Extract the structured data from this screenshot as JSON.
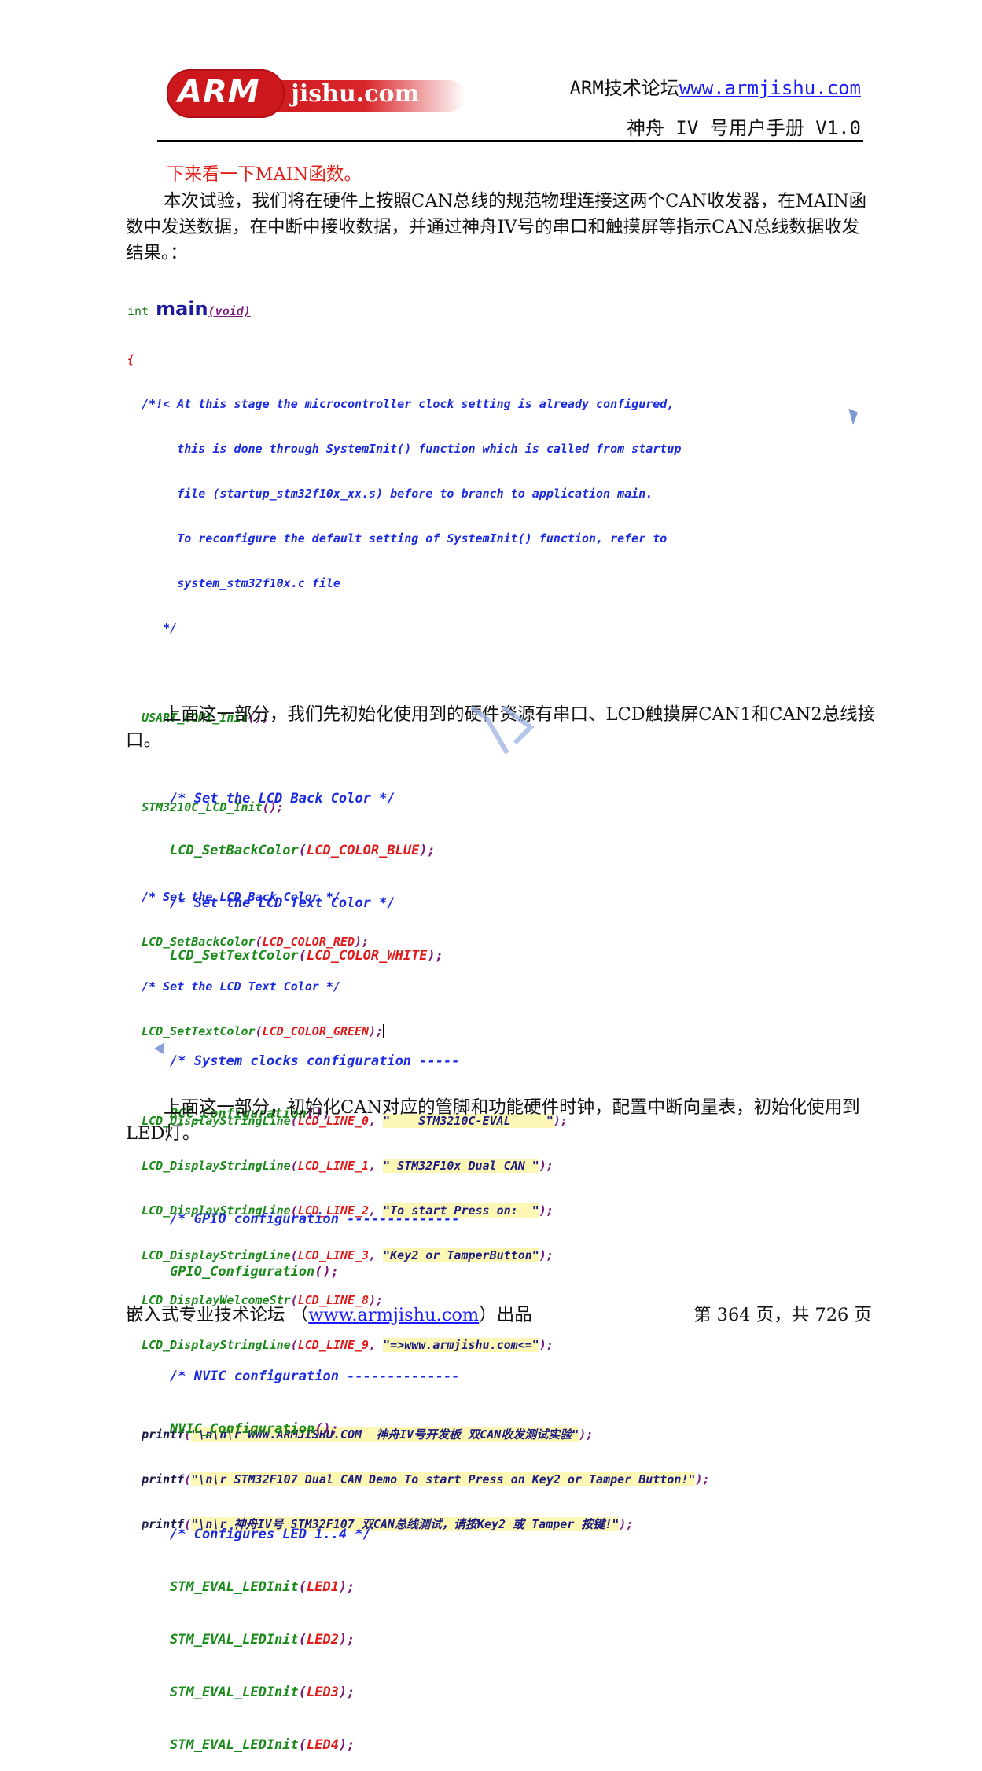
{
  "header": {
    "logo": {
      "arm": "ARM",
      "jishu": "jishu.com"
    },
    "forum_label": "ARM技术论坛",
    "forum_url": "www.armjishu.com",
    "manual_title": "神舟 IV 号用户手册 V1.0"
  },
  "colors": {
    "accent_red": "#e0201b",
    "link_blue": "#1a1aff",
    "code_green": "#1a8a1a",
    "code_comment_blue": "#1a2ae0",
    "code_arg_red": "#e01a1a",
    "code_paren_purple": "#7a1a7a",
    "string_highlight": "#fdf7b6"
  },
  "body": {
    "heading": "下来看一下MAIN函数。",
    "intro": "本次试验，我们将在硬件上按照CAN总线的规范物理连接这两个CAN收发器，在MAIN函数中发送数据，在中断中接收数据，并通过神舟IV号的串口和触摸屏等指示CAN总线数据收发结果。：",
    "para2": "上面这一部分，我们先初始化使用到的硬件资源有串口、LCD触摸屏CAN1和CAN2总线接口。",
    "para3": "上面这一部分，初始化CAN对应的管脚和功能硬件时钟，配置中断向量表，初始化使用到LED灯。"
  },
  "code1": {
    "sig_type": "int",
    "sig_name": "main",
    "sig_args": "(void)",
    "open_brace": "{",
    "comment": [
      "/*!< At this stage the microcontroller clock setting is already configured,",
      "     this is done through SystemInit() function which is called from startup",
      "     file (startup_stm32f10x_xx.s) before to branch to application main.",
      "     To reconfigure the default setting of SystemInit() function, refer to",
      "     system_stm32f10x.c file",
      "   */"
    ],
    "usart_init": "USART_COM1_Init",
    "lcd_init": "STM3210C_LCD_Init",
    "empty_call": "();",
    "cm_back": "/* Set the LCD Back Color */",
    "set_back_fn": "LCD_SetBackColor",
    "set_back_arg": "LCD_COLOR_RED",
    "cm_text": "/* Set the LCD Text Color */",
    "set_text_fn": "LCD_SetTextColor",
    "set_text_arg": "LCD_COLOR_GREEN",
    "display_lines": [
      {
        "fn": "LCD_DisplayStringLine",
        "arg": "LCD_LINE_0",
        "str": "\"    STM3210C-EVAL     \""
      },
      {
        "fn": "LCD_DisplayStringLine",
        "arg": "LCD_LINE_1",
        "str": "\" STM32F10x Dual CAN \""
      },
      {
        "fn": "LCD_DisplayStringLine",
        "arg": "LCD_LINE_2",
        "str": "\"To start Press on:  \""
      },
      {
        "fn": "LCD_DisplayStringLine",
        "arg": "LCD_LINE_3",
        "str": "\"Key2 or TamperButton\""
      },
      {
        "fn": "LCD_DisplayWelcomeStr",
        "arg": "LCD_LINE_8",
        "str": ""
      },
      {
        "fn": "LCD_DisplayStringLine",
        "arg": "LCD_LINE_9",
        "str": "\"=>www.armjishu.com<=\""
      }
    ],
    "printf_fn": "printf",
    "printf_lines": [
      "\"\\n\\n\\r WWW.ARMJISHU.COM  神舟IV号开发板 双CAN收发测试实验\"",
      "\"\\n\\r STM32F107 Dual CAN Demo To start Press on Key2 or Tamper Button!\"",
      "\"\\n\\r 神舟IV号 STM32F107 双CAN总线测试，请按Key2 或 Tamper 按键!\""
    ]
  },
  "code2": {
    "cm_back": "/* Set the LCD Back Color */",
    "set_back_fn": "LCD_SetBackColor",
    "set_back_arg": "LCD_COLOR_BLUE",
    "cm_text": "/* Set the LCD Text Color */",
    "set_text_fn": "LCD_SetTextColor",
    "set_text_arg": "LCD_COLOR_WHITE",
    "cm_rcc": "/* System clocks configuration -----",
    "rcc_fn": "RCC_Configuration",
    "cm_gpio": "/* GPIO configuration --------------",
    "gpio_fn": "GPIO_Configuration",
    "cm_nvic": "/* NVIC configuration --------------",
    "nvic_fn": "NVIC_Configuration",
    "empty_call": "();",
    "cm_led": "/* Configures LED 1..4 */",
    "led_fn": "STM_EVAL_LEDInit",
    "leds": [
      "LED1",
      "LED2",
      "LED3",
      "LED4"
    ]
  },
  "footer": {
    "left_prefix": "嵌入式专业技术论坛 （",
    "left_url": "www.armjishu.com",
    "left_suffix": "）出品",
    "page_info": "第 364 页，共 726 页"
  }
}
